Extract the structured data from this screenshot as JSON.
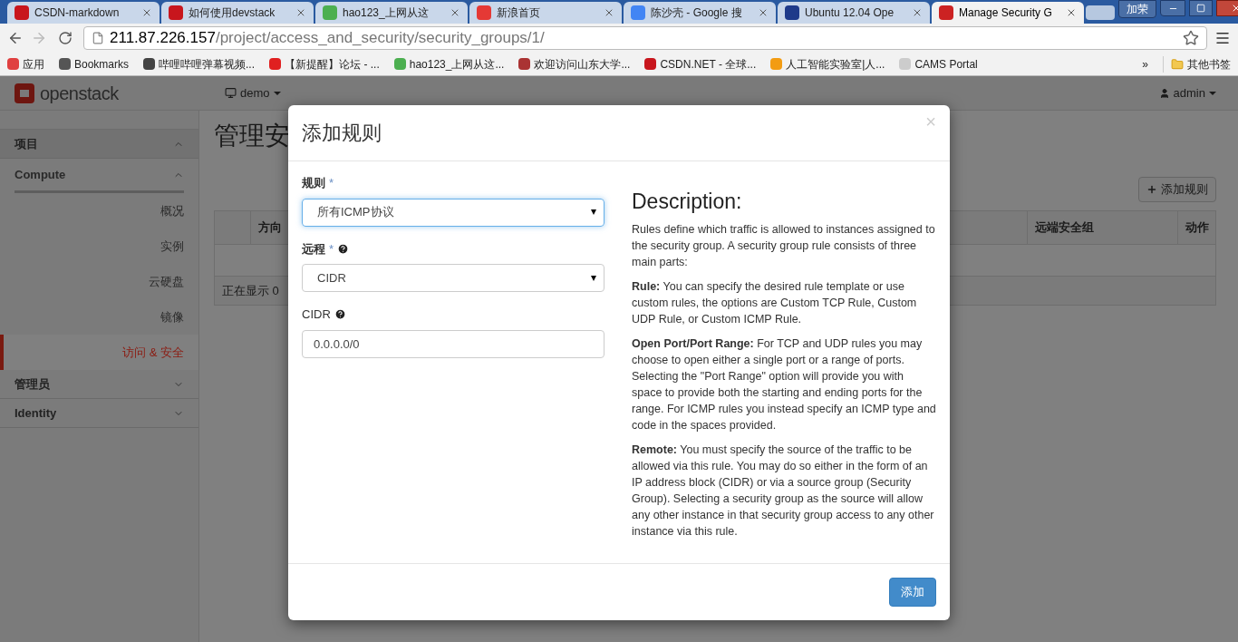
{
  "browser": {
    "tabs": [
      {
        "title": "CSDN-markdown",
        "selected": false
      },
      {
        "title": "如何使用devstack",
        "selected": false
      },
      {
        "title": "hao123_上网从这",
        "selected": false
      },
      {
        "title": "新浪首页",
        "selected": false
      },
      {
        "title": "陈沙壳 - Google 搜",
        "selected": false
      },
      {
        "title": "Ubuntu 12.04 Ope",
        "selected": false
      },
      {
        "title": "Manage Security G",
        "selected": true
      }
    ],
    "profile": "加荣",
    "address": {
      "host": "211.87.226.157",
      "path": "/project/access_and_security/security_groups/1/"
    },
    "bookmarks": [
      {
        "label": "应用"
      },
      {
        "label": "Bookmarks"
      },
      {
        "label": "哔哩哔哩弹幕视频..."
      },
      {
        "label": "【新提醒】论坛 - ..."
      },
      {
        "label": "hao123_上网从这..."
      },
      {
        "label": "欢迎访问山东大学..."
      },
      {
        "label": "CSDN.NET - 全球..."
      },
      {
        "label": "人工智能实验室|人..."
      },
      {
        "label": "CAMS Portal"
      }
    ],
    "more": "»",
    "other_bookmarks": "其他书签"
  },
  "header": {
    "logo": "openstack",
    "project": "demo",
    "user": "admin"
  },
  "sidebar": [
    {
      "label": "项目",
      "expanded": true,
      "children": [
        {
          "label": "Compute",
          "expanded": true,
          "children": [
            {
              "label": "概况",
              "selected": false
            },
            {
              "label": "实例",
              "selected": false
            },
            {
              "label": "云硬盘",
              "selected": false
            },
            {
              "label": "镜像",
              "selected": false
            },
            {
              "label": "访问 & 安全",
              "selected": true
            }
          ]
        }
      ]
    },
    {
      "label": "管理员",
      "expanded": false
    },
    {
      "label": "Identity",
      "expanded": false
    }
  ],
  "page": {
    "title": "管理安",
    "add_button": "添加规则",
    "table": {
      "columns": [
        "方向",
        "远端安全组",
        "动作"
      ],
      "footer": "正在显示 0"
    }
  },
  "dialog": {
    "title": "添加规则",
    "close": "×",
    "fields": [
      {
        "kind": "select",
        "label": "规则",
        "required": "*",
        "help": false,
        "value": "所有ICMP协议",
        "focused": true
      },
      {
        "kind": "select",
        "label": "远程",
        "required": "*",
        "help": true,
        "value": "CIDR",
        "focused": false
      },
      {
        "kind": "text",
        "label": "CIDR",
        "help": true,
        "value": "0.0.0.0/0",
        "focused": false
      }
    ],
    "description_title": "Description:",
    "description": [
      "Rules define which traffic is allowed to instances assigned to the security group. A security group rule consists of three main parts:",
      "**Rule:** You can specify the desired rule template or use custom rules, the options are Custom TCP Rule, Custom UDP Rule, or Custom ICMP Rule.",
      "**Open Port/Port Range:** For TCP and UDP rules you may choose to open either a single port or a range of ports. Selecting the \"Port Range\" option will provide you with space to provide both the starting and ending ports for the range. For ICMP rules you instead specify an ICMP type and code in the spaces provided.",
      "**Remote:** You must specify the source of the traffic to be allowed via this rule. You may do so either in the form of an IP address block (CIDR) or via a source group (Security Group). Selecting a security group as the source will allow any other instance in that security group access to any other instance via this rule."
    ],
    "submit": "添加"
  }
}
